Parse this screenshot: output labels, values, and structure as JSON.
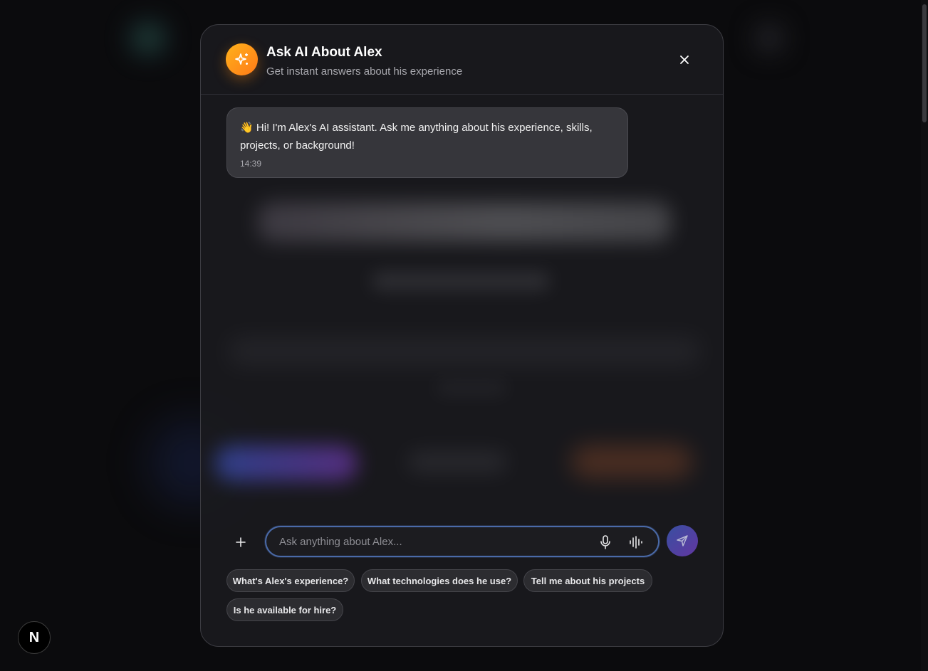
{
  "modal": {
    "title": "Ask AI About Alex",
    "subtitle": "Get instant answers about his experience"
  },
  "messages": [
    {
      "emoji": "👋",
      "text": "Hi! I'm Alex's AI assistant. Ask me anything about his experience, skills, projects, or background!",
      "time": "14:39"
    }
  ],
  "composer": {
    "placeholder": "Ask anything about Alex...",
    "value": ""
  },
  "suggestions": [
    "What's Alex's experience?",
    "What technologies does he use?",
    "Tell me about his projects",
    "Is he available for hire?"
  ],
  "corner_badge": "N",
  "icons": {
    "ai_badge": "sparkles-icon",
    "close": "close-icon",
    "attach": "plus-icon",
    "mic": "microphone-icon",
    "voice": "audio-wave-icon",
    "send": "send-icon"
  },
  "colors": {
    "accent_orange": "#ff9a1a",
    "send_gradient_start": "#3d56b0",
    "send_gradient_end": "#6a3ab0",
    "input_border": "#4a6aa8"
  }
}
